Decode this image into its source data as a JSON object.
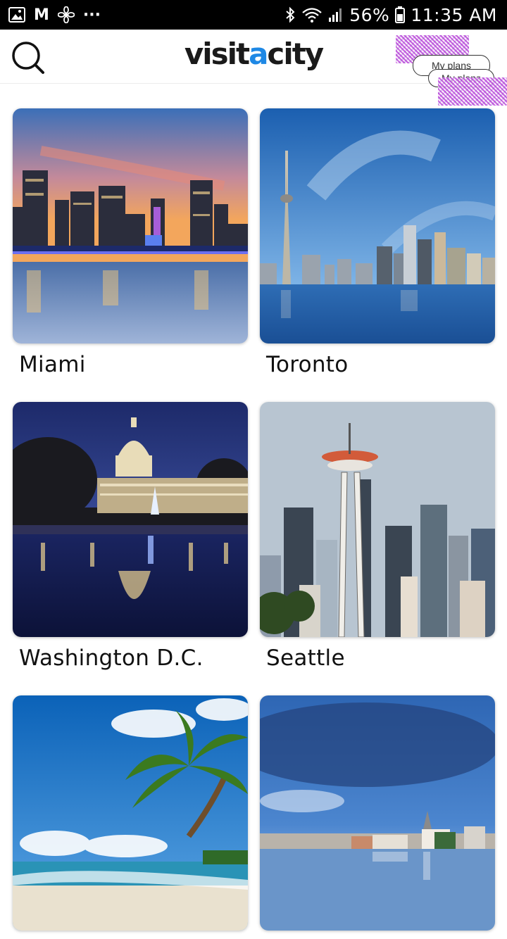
{
  "status_bar": {
    "left_icons": [
      "gallery-icon",
      "gmail-icon",
      "fan-icon",
      "more-dots-icon"
    ],
    "gmail_letter": "M",
    "more_dots": "···",
    "right_icons": [
      "bluetooth-icon",
      "wifi-icon",
      "signal-icon",
      "battery-icon"
    ],
    "battery": "56%",
    "time": "11:35 AM"
  },
  "header": {
    "logo_part1": "visit",
    "logo_accent": "a",
    "logo_part2": "city",
    "my_plans": "My plans",
    "accent_color": "#1e88e5"
  },
  "cities": [
    {
      "name": "Miami"
    },
    {
      "name": "Toronto"
    },
    {
      "name": "Washington D.C."
    },
    {
      "name": "Seattle"
    },
    {
      "name": ""
    },
    {
      "name": ""
    }
  ]
}
